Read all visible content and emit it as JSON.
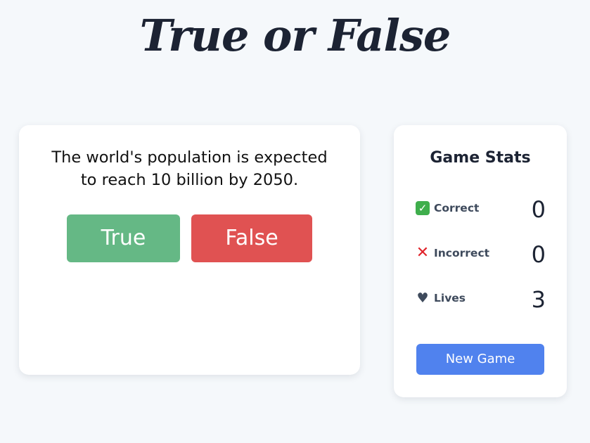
{
  "header": {
    "title": "True or False"
  },
  "question_panel": {
    "question_line1": "The world's population is expected",
    "question_line2": "to reach 10 billion by 2050.",
    "true_label": "True",
    "false_label": "False"
  },
  "stats": {
    "title": "Game Stats",
    "items": [
      {
        "icon": "check-mark-icon",
        "label": "Correct",
        "value": "0"
      },
      {
        "icon": "cross-mark-icon",
        "label": "Incorrect",
        "value": "0"
      },
      {
        "icon": "heart-icon",
        "label": "Lives",
        "value": "3"
      }
    ],
    "new_game_label": "New Game"
  },
  "colors": {
    "background": "#f5f8fb",
    "true_button": "#65b885",
    "false_button": "#e05252",
    "new_game_button": "#5082ee",
    "title_text": "#1c2333"
  }
}
